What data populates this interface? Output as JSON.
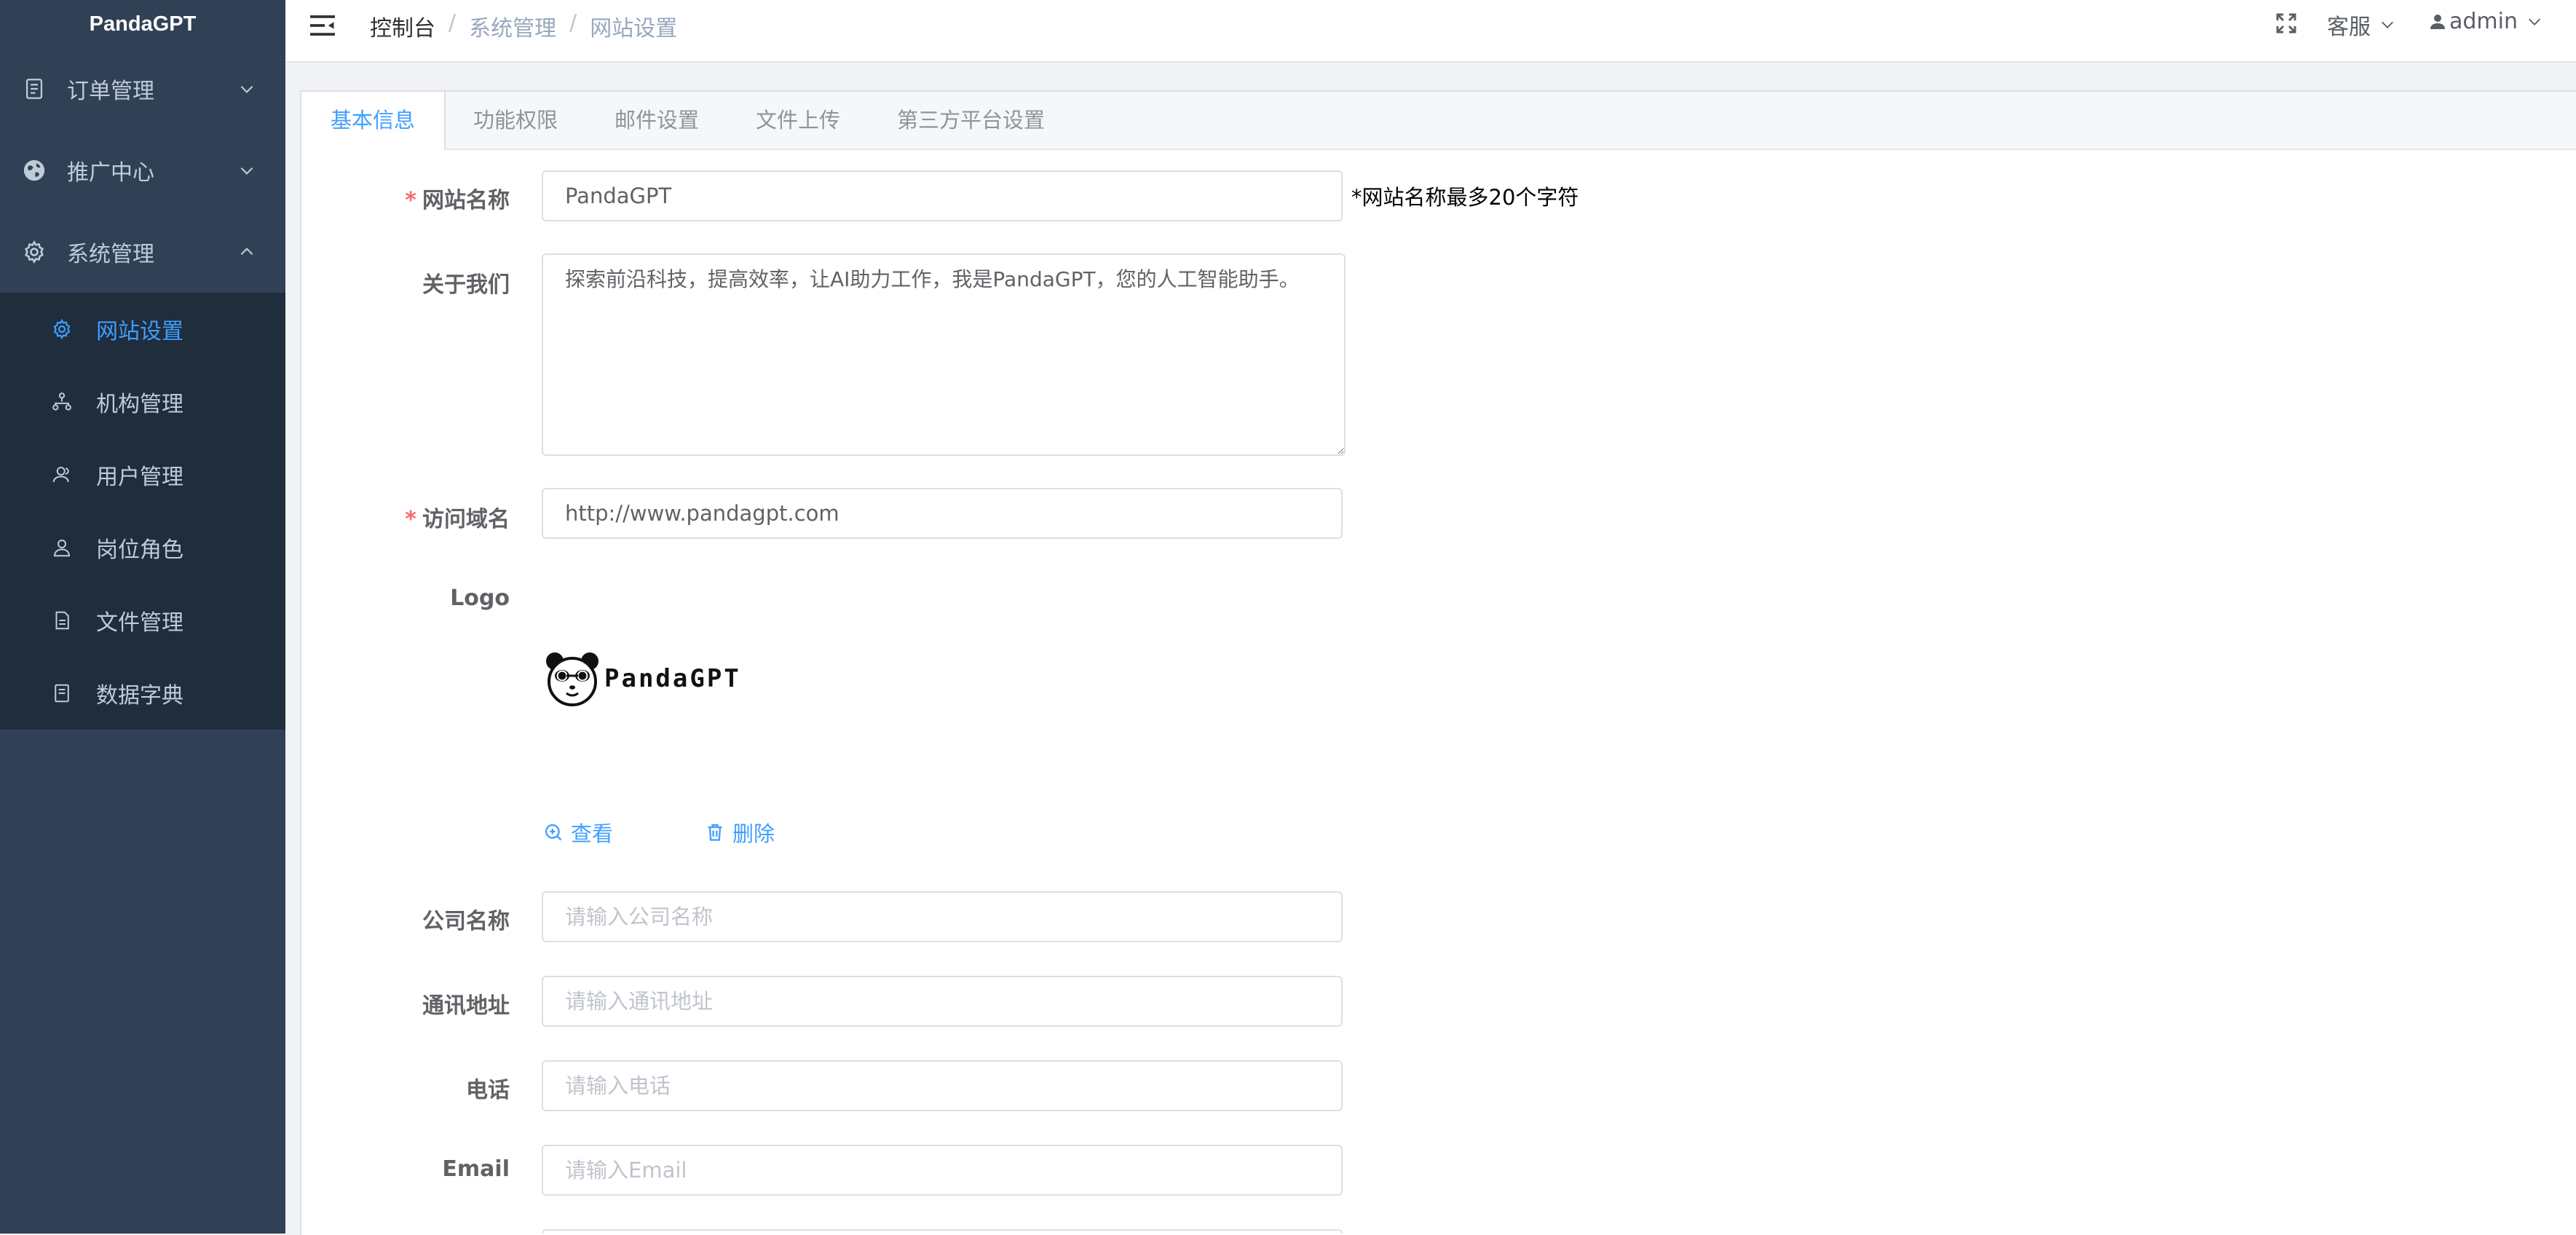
{
  "app": {
    "brand": "PandaGPT"
  },
  "sidebar": {
    "menus": [
      {
        "label": "订单管理",
        "icon": "document-icon"
      },
      {
        "label": "推广中心",
        "icon": "globe-icon"
      },
      {
        "label": "系统管理",
        "icon": "gear-icon"
      }
    ],
    "submenu": [
      {
        "label": "网站设置",
        "icon": "gear-icon",
        "active": true
      },
      {
        "label": "机构管理",
        "icon": "org-tree-icon"
      },
      {
        "label": "用户管理",
        "icon": "user-group-icon"
      },
      {
        "label": "岗位角色",
        "icon": "person-icon"
      },
      {
        "label": "文件管理",
        "icon": "file-icon"
      },
      {
        "label": "数据字典",
        "icon": "dictionary-icon"
      }
    ]
  },
  "header": {
    "breadcrumb": [
      "控制台",
      "系统管理",
      "网站设置"
    ],
    "kefu": "客服",
    "user": "admin"
  },
  "tabs": [
    "基本信息",
    "功能权限",
    "邮件设置",
    "文件上传",
    "第三方平台设置"
  ],
  "form": {
    "site_name": {
      "label": "网站名称",
      "value": "PandaGPT",
      "hint": "*网站名称最多20个字符"
    },
    "about": {
      "label": "关于我们",
      "value": "探索前沿科技，提高效率，让AI助力工作，我是PandaGPT，您的人工智能助手。"
    },
    "domain": {
      "label": "访问域名",
      "value": "http://www.pandagpt.com"
    },
    "logo": {
      "label": "Logo",
      "logo_text": "PandaGPT",
      "view": "查看",
      "delete": "删除"
    },
    "company": {
      "label": "公司名称",
      "placeholder": "请输入公司名称"
    },
    "address": {
      "label": "通讯地址",
      "placeholder": "请输入通讯地址"
    },
    "phone": {
      "label": "电话",
      "placeholder": "请输入电话"
    },
    "email": {
      "label": "Email",
      "placeholder": "请输入Email"
    }
  },
  "colors": {
    "sidebar_bg": "#304156",
    "submenu_bg": "#1f2d3d",
    "accent": "#409eff",
    "required": "#f56c6c"
  }
}
